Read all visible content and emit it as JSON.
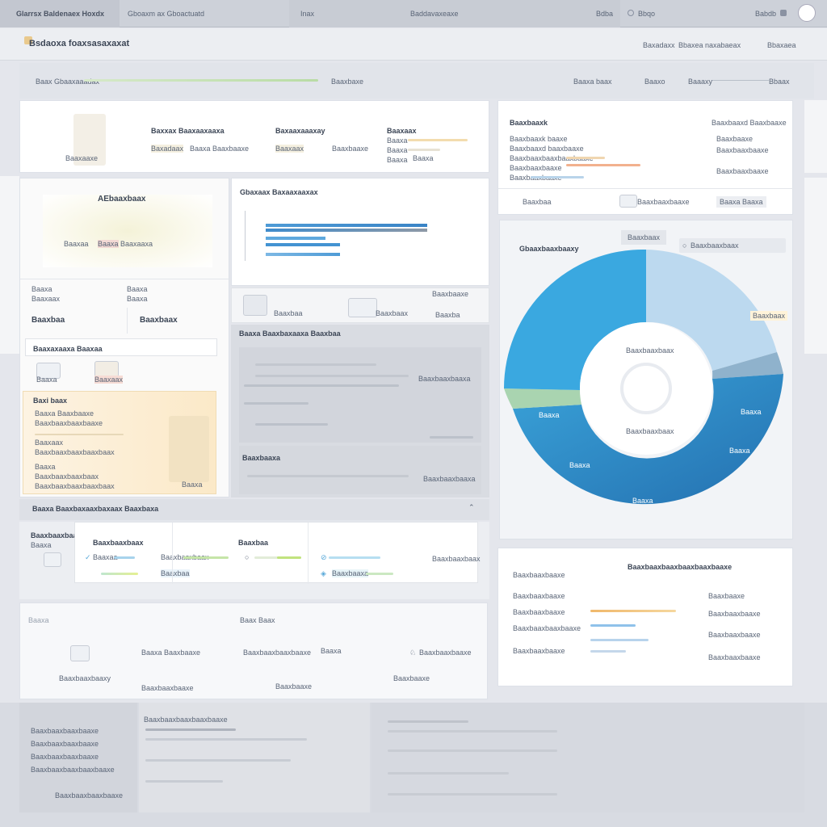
{
  "topbar": {
    "left_title": "Glarrsx Baldenaex Hoxdx",
    "second_title": "Gboaxm ax Gboactuatd",
    "tab_a": "Inax",
    "tab_b": "Baddavaxeaxe",
    "tab_c": "Bdba",
    "search_label": "Bbqo",
    "user_label": "Babdb"
  },
  "subbar": {
    "page_title": "Bsdaoxa foaxsasaxaxat",
    "link_a": "Baxadaxx",
    "link_b": "Bbaxea naxabaeax",
    "link_c": "Bbaxaea"
  },
  "breadcrumb": {
    "label": "Baax Gbaaxaaadax",
    "value": "Baaxbaxe",
    "right_a": "Baaxa baax",
    "right_b": "Baaxo",
    "right_c": "Baaaxy",
    "right_d": "Bbaax"
  },
  "summary_card": {
    "title_a": "Baxxax Baaxaaxaaxa",
    "title_b": "Baxaaxaaaxay",
    "title_c": "Baaxaax",
    "value_a": "Baxadaax",
    "value_a2": "Baaxa Baaxbaaxe",
    "value_b": "Baaxaax",
    "value_b2": "Baaxbaaxe",
    "row_c1": "Baaxa",
    "row_c2": "Baaxa",
    "row_c3": "Baaxa",
    "row_c4": "Baaxa",
    "icon_caption": "Baaxaaxe"
  },
  "map_card": {
    "title": "AEbaaxbaax",
    "label_a": "Baaxaa",
    "label_b": "Baaxa",
    "label_c": "Baaxaaxa",
    "stat_a_label": "Baaxa",
    "stat_a_sub": "Baaxaax",
    "stat_b_label": "Baaxa",
    "stat_b_sub": "Baaxa",
    "stat_a_value": "Baaxbaa",
    "stat_b_value": "Baaxbaax",
    "section": "Baaxaxaaxa Baaxaa",
    "item_a": "Baaxa",
    "item_b": "Baaxaax"
  },
  "note_card": {
    "title": "Baxi baax",
    "lines": [
      "Baaxa Baaxbaaxe",
      "Baaxbaaxbaaxbaaxe",
      "Baaxaax",
      "Baaxbaaxbaaxbaaxbaax",
      "Baaxa",
      "Baaxbaaxbaaxbaax",
      "Baaxbaaxbaaxbaaxbaax"
    ],
    "stamp": "Baaxa"
  },
  "bar_card": {
    "title": "Gbaxaax Baxaaxaaxax",
    "bottom_a": "Baaxbaa",
    "bottom_b": "Baaxbaax",
    "bottom_c": "Baaxbaaxe",
    "bottom_c2": "Baaxba"
  },
  "list_panel": {
    "header": "Baaxa Baaxbaxaaxa Baaxbaa",
    "row_a_right": "Baaxbaaxbaaxa",
    "section_b": "Baaxbaaxa",
    "row_b_right": "Baaxbaaxbaaxa"
  },
  "table": {
    "header": "Baaxa Baaxbaxaaxbaxaax Baaxbaxa",
    "col_a": "Baaxbaaxbaax",
    "col_a_sub": "Baaxa",
    "col_b": "Baaxbaaxbaax",
    "col_c": "Baaxbaa",
    "col_d": "Baaxbaaxbaax",
    "row_b": "Baaxaa",
    "row_b2": "Baaxbaaxbaax",
    "row_c": "Baaxbaa",
    "row_d": "Baaxbaaxa"
  },
  "bottom_strip": {
    "label_a": "Baaxa",
    "label_b": "Baax Baax",
    "item_a_top": "Baaxbaaxbaax",
    "item_a": "Baaxbaaxbaaxy",
    "item_b": "Baaxa Baaxbaaxe",
    "item_b2": "Baaxbaaxbaaxe",
    "item_c": "Baaxbaaxbaaxbaaxe",
    "item_c2": "Baaxa",
    "item_d": "Baaxbaaxe",
    "item_e": "Baaxbaaxbaaxe",
    "item_e2": "Baaxbaaxe"
  },
  "side_top_card": {
    "title": "Baaxbaaxk",
    "title_right": "Baaxbaaxd Baaxbaaxe",
    "rows": [
      "Baaxbaaxk baaxe",
      "Baaxbaaxd baaxbaaxe",
      "Baaxbaaxbaaxbaaxbaaxe",
      "Baaxbaaxbaaxe",
      "Baaxbaaxbaaxe"
    ],
    "right_rows": [
      "Baaxbaaxe",
      "Baaxbaaxbaaxe",
      "Baaxbaaxbaaxe"
    ],
    "footer_left": "Baaxbaa",
    "footer_mid": "Baaxbaaxbaaxe",
    "footer_right": "Baaxa Baaxa"
  },
  "donut_card": {
    "title": "Gbaaxbaaxbaaxy",
    "badge": "Baaxbaax",
    "search_placeholder": "Baaxbaaxbaax",
    "center_top": "Baaxbaaxbaax",
    "center_bottom": "Baaxbaaxbaax",
    "label_top_right": "Baaxbaax",
    "label_right": "Baaxa",
    "label_right2": "Baaxa",
    "label_bottom": "Baaxa",
    "label_left": "Baaxa",
    "label_left2": "Baaxa"
  },
  "legend_card": {
    "title": "Baaxbaaxbaaxbaaxbaaxbaaxe",
    "subtitle": "Baaxbaaxbaaxe",
    "rows": [
      "Baaxbaaxbaaxe",
      "Baaxbaaxbaaxe",
      "Baaxbaaxbaaxbaaxe",
      "Baaxbaaxbaaxe"
    ],
    "right_rows": [
      "Baaxbaaxe",
      "Baaxbaaxbaaxe",
      "Baaxbaaxbaaxe",
      "Baaxbaaxbaaxe"
    ]
  },
  "footer": {
    "label_a": "Baaxbaaxbaaxbaaxbaaxe",
    "rows": [
      "Baaxbaaxbaaxbaaxe",
      "Baaxbaaxbaaxbaaxe",
      "Baaxbaaxbaaxbaaxe",
      "Baaxbaaxbaaxbaaxbaaxe"
    ],
    "bottom_label": "Baaxbaaxbaaxbaaxe"
  },
  "colors": {
    "accent_blue": "#3a9bd9",
    "dark_blue": "#2a74b4",
    "light_blue": "#bcd9ef",
    "green": "#a9d4b0",
    "orange": "#f0b27a"
  }
}
